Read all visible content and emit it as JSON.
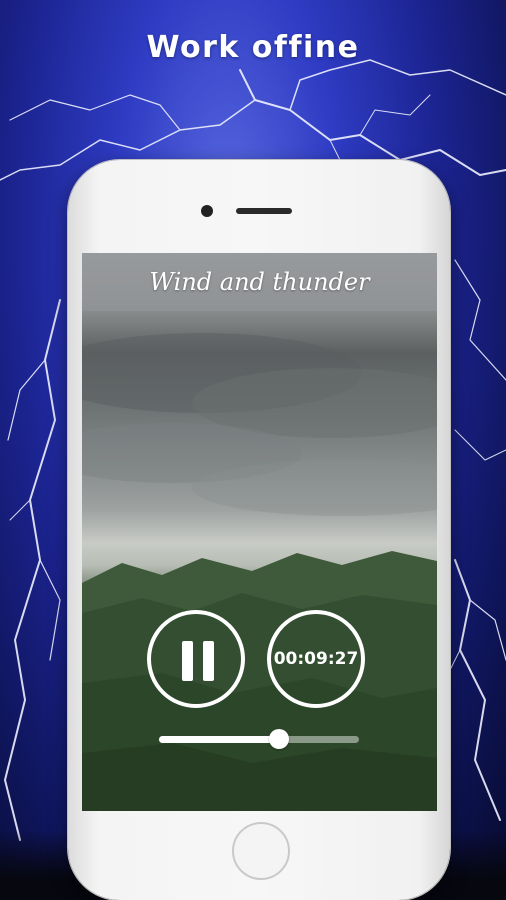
{
  "banner": {
    "headline": "Work offine"
  },
  "player": {
    "title": "Wind and thunder",
    "timer": "00:09:27",
    "state": "playing",
    "control_icon": "pause-icon",
    "volume_level": 0.6
  },
  "colors": {
    "background": "#2f3cc4",
    "accent": "#ffffff"
  }
}
